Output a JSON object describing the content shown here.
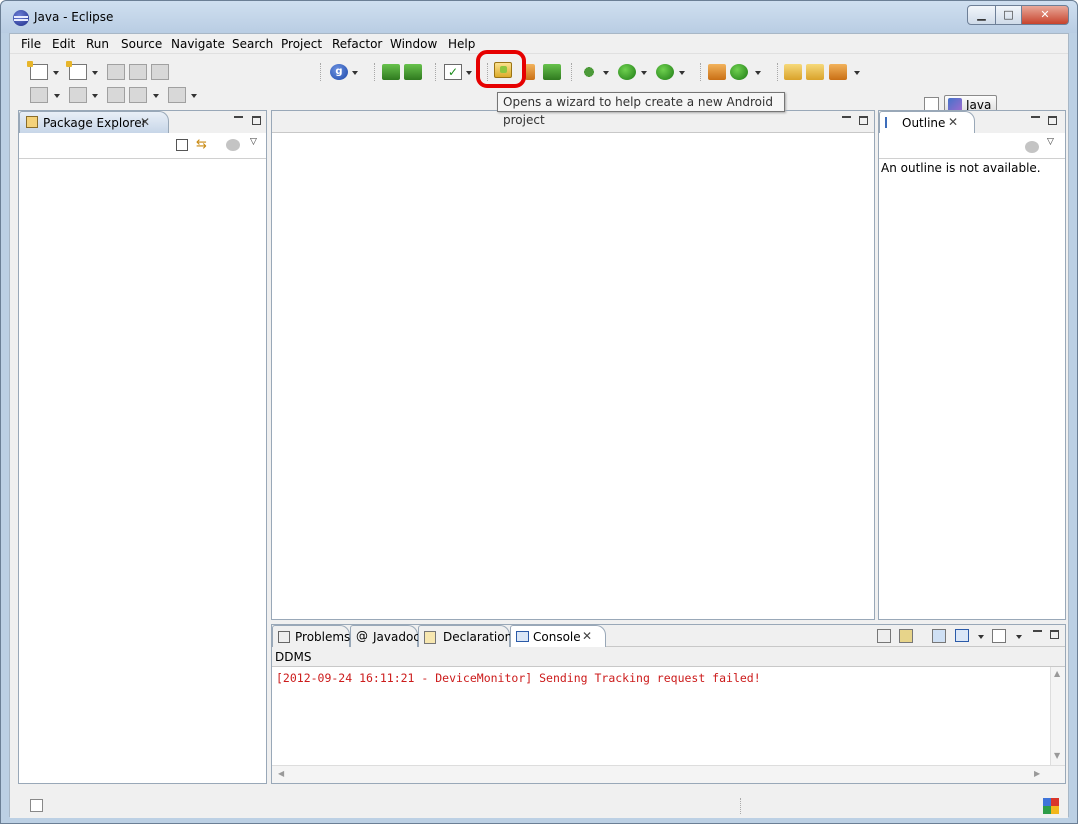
{
  "window": {
    "title": "Java - Eclipse"
  },
  "menu": [
    "File",
    "Edit",
    "Run",
    "Source",
    "Navigate",
    "Search",
    "Project",
    "Refactor",
    "Window",
    "Help"
  ],
  "tooltip": "Opens a wizard to help create a new Android project",
  "perspective": {
    "label": "Java"
  },
  "package_explorer": {
    "title": "Package Explorer"
  },
  "outline": {
    "title": "Outline",
    "message": "An outline is not available."
  },
  "bottom_tabs": [
    "Problems",
    "Javadoc",
    "Declaration",
    "Console"
  ],
  "console": {
    "name": "DDMS",
    "line": "[2012-09-24 16:11:21 - DeviceMonitor] Sending Tracking request failed!",
    "text_color": "#cc1b1b"
  }
}
